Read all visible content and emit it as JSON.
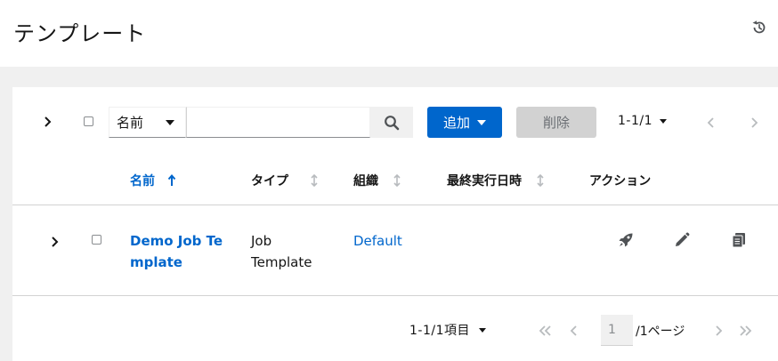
{
  "header": {
    "title": "テンプレート"
  },
  "toolbar": {
    "filter_select": "名前",
    "search_placeholder": "",
    "add_label": "追加",
    "delete_label": "削除",
    "pagination": "1-1/1"
  },
  "table": {
    "columns": [
      {
        "label": "名前",
        "sorted": "ascending"
      },
      {
        "label": "タイプ",
        "sorted": "none"
      },
      {
        "label": "組織",
        "sorted": "none"
      },
      {
        "label": "最終実行日時",
        "sorted": "none"
      },
      {
        "label": "アクション"
      }
    ],
    "rows": [
      {
        "name": "Demo Job Template",
        "name_line1": "Demo Job Te",
        "name_line2": "mplate",
        "type_line1": "Job",
        "type_line2": "Template",
        "organization": "Default",
        "last_run": "",
        "actions": [
          "rocket-icon",
          "pencil-icon",
          "copy-icon"
        ]
      }
    ]
  },
  "footer": {
    "count": "1-1/1項目",
    "page": "1",
    "page_of": "/1ページ"
  },
  "colors": {
    "primary": "#0066cc",
    "disabled": "#d2d2d2",
    "background": "#f0f0f0"
  }
}
